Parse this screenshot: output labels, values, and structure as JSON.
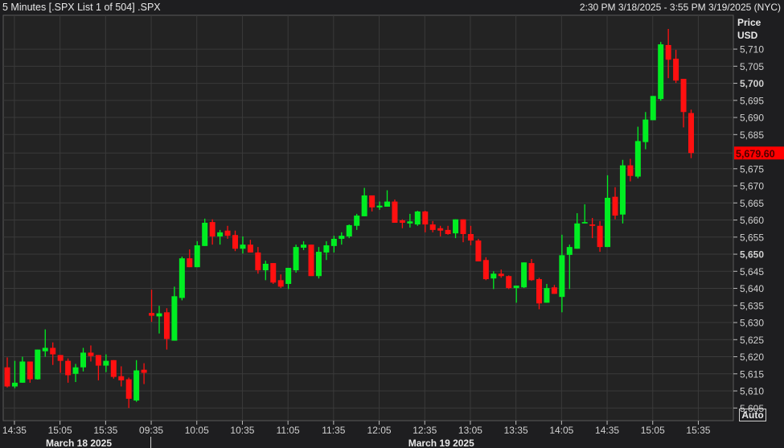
{
  "header": {
    "title": "5 Minutes [.SPX List 1 of 504] .SPX",
    "range": "2:30 PM 3/18/2025 - 3:55 PM 3/19/2025 (NYC)"
  },
  "auto_button": "Auto",
  "colors": {
    "up": "#00ee22",
    "down": "#ff1010",
    "last_price_bg": "#ff0000",
    "grid": "#3a3a3a",
    "plot_bg": "#232323"
  },
  "chart_data": {
    "type": "candlestick",
    "title": "5 Minutes [.SPX List 1 of 504] .SPX",
    "ylabel": "Price",
    "yunit": "USD",
    "ylim": [
      5601.3,
      5719.9
    ],
    "yticks": [
      5710,
      5705,
      5700,
      5695,
      5690,
      5685,
      5675,
      5670,
      5665,
      5660,
      5655,
      5650,
      5645,
      5640,
      5635,
      5630,
      5625,
      5620,
      5615,
      5610,
      5605
    ],
    "ytick_labels": [
      "5,710",
      "5,705",
      "5,700",
      "5,695",
      "5,690",
      "5,685",
      "5,675",
      "5,670",
      "5,665",
      "5,660",
      "5,655",
      "5,650",
      "5,645",
      "5,640",
      "5,635",
      "5,630",
      "5,625",
      "5,620",
      "5,615",
      "5,610",
      "5,605"
    ],
    "ytick_bold": [
      "5,700",
      "5,650"
    ],
    "last_price": 5679.6,
    "last_price_label": "5,679.60",
    "grid": true,
    "xtick_labels": [
      {
        "label": "14:35",
        "index": 1
      },
      {
        "label": "15:05",
        "index": 7
      },
      {
        "label": "15:35",
        "index": 13
      },
      {
        "label": "09:35",
        "index": 19
      },
      {
        "label": "10:05",
        "index": 25
      },
      {
        "label": "10:35",
        "index": 31
      },
      {
        "label": "11:05",
        "index": 37
      },
      {
        "label": "11:35",
        "index": 43
      },
      {
        "label": "12:05",
        "index": 49
      },
      {
        "label": "12:35",
        "index": 55
      },
      {
        "label": "13:05",
        "index": 61
      },
      {
        "label": "13:35",
        "index": 67
      },
      {
        "label": "14:05",
        "index": 73
      },
      {
        "label": "14:35",
        "index": 79
      },
      {
        "label": "15:05",
        "index": 85
      },
      {
        "label": "15:35",
        "index": 91
      }
    ],
    "date_labels": [
      {
        "label": "March 18 2025",
        "from": 0,
        "to": 18
      },
      {
        "label": "March 19 2025",
        "from": 19,
        "to": 91
      }
    ],
    "columns": [
      "time",
      "open",
      "high",
      "low",
      "close"
    ],
    "candles": [
      [
        "3/18 14:30",
        5616.9,
        5619.8,
        5611.0,
        5611.3
      ],
      [
        "3/18 14:35",
        5611.3,
        5618.8,
        5610.8,
        5612.4
      ],
      [
        "3/18 14:40",
        5612.4,
        5620.0,
        5612.4,
        5618.6
      ],
      [
        "3/18 14:45",
        5618.6,
        5618.6,
        5612.4,
        5613.4
      ],
      [
        "3/18 14:50",
        5613.4,
        5622.1,
        5613.3,
        5622.1
      ],
      [
        "3/18 14:55",
        5621.6,
        5628.0,
        5620.0,
        5622.6
      ],
      [
        "3/18 15:00",
        5622.6,
        5624.2,
        5617.6,
        5620.7
      ],
      [
        "3/18 15:05",
        5620.5,
        5620.5,
        5615.3,
        5618.8
      ],
      [
        "3/18 15:10",
        5618.8,
        5619.5,
        5612.4,
        5614.6
      ],
      [
        "3/18 15:15",
        5615.0,
        5617.9,
        5612.6,
        5616.9
      ],
      [
        "3/18 15:20",
        5616.9,
        5622.6,
        5615.7,
        5621.2
      ],
      [
        "3/18 15:25",
        5621.2,
        5623.3,
        5618.6,
        5620.2
      ],
      [
        "3/18 15:30",
        5620.5,
        5620.5,
        5613.1,
        5617.4
      ],
      [
        "3/18 15:35",
        5617.4,
        5620.7,
        5615.5,
        5618.8
      ],
      [
        "3/18 15:40",
        5619.0,
        5619.0,
        5613.6,
        5614.1
      ],
      [
        "3/18 15:45",
        5614.3,
        5617.2,
        5611.3,
        5613.1
      ],
      [
        "3/18 15:50",
        5613.4,
        5613.9,
        5605.0,
        5607.7
      ],
      [
        "3/18 15:55",
        5607.2,
        5619.0,
        5606.8,
        5616.0
      ],
      [
        "3/18 16:00",
        5616.2,
        5618.1,
        5612.0,
        5615.3
      ],
      [
        "3/19 09:35",
        5632.8,
        5639.6,
        5630.2,
        5632.0
      ],
      [
        "3/19 09:40",
        5631.8,
        5634.9,
        5626.8,
        5632.7
      ],
      [
        "3/19 09:45",
        5633.0,
        5634.2,
        5622.1,
        5625.2
      ],
      [
        "3/19 09:50",
        5624.7,
        5640.5,
        5624.7,
        5637.7
      ],
      [
        "3/19 09:55",
        5637.2,
        5649.3,
        5636.5,
        5648.8
      ],
      [
        "3/19 10:00",
        5648.8,
        5651.4,
        5646.2,
        5646.2
      ],
      [
        "3/19 10:05",
        5646.2,
        5653.8,
        5646.2,
        5652.6
      ],
      [
        "3/19 10:10",
        5652.4,
        5660.4,
        5652.4,
        5659.2
      ],
      [
        "3/19 10:15",
        5659.4,
        5660.2,
        5652.8,
        5655.2
      ],
      [
        "3/19 10:20",
        5655.2,
        5657.1,
        5652.8,
        5656.4
      ],
      [
        "3/19 10:25",
        5656.9,
        5658.3,
        5654.5,
        5655.4
      ],
      [
        "3/19 10:30",
        5655.6,
        5656.9,
        5650.9,
        5651.6
      ],
      [
        "3/19 10:35",
        5651.6,
        5655.2,
        5650.2,
        5652.8
      ],
      [
        "3/19 10:40",
        5652.8,
        5654.2,
        5650.5,
        5650.5
      ],
      [
        "3/19 10:45",
        5650.5,
        5652.1,
        5644.3,
        5645.3
      ],
      [
        "3/19 10:50",
        5645.3,
        5648.1,
        5642.4,
        5647.2
      ],
      [
        "3/19 10:55",
        5647.4,
        5647.4,
        5641.3,
        5641.7
      ],
      [
        "3/19 11:00",
        5642.4,
        5644.1,
        5640.1,
        5640.5
      ],
      [
        "3/19 11:05",
        5641.3,
        5646.0,
        5639.8,
        5646.0
      ],
      [
        "3/19 11:10",
        5645.3,
        5652.8,
        5644.6,
        5652.1
      ],
      [
        "3/19 11:15",
        5651.9,
        5653.8,
        5651.2,
        5652.8
      ],
      [
        "3/19 11:20",
        5652.8,
        5652.8,
        5643.6,
        5643.6
      ],
      [
        "3/19 11:25",
        5643.6,
        5652.1,
        5642.9,
        5650.7
      ],
      [
        "3/19 11:30",
        5650.5,
        5653.8,
        5648.3,
        5652.6
      ],
      [
        "3/19 11:35",
        5652.4,
        5655.4,
        5650.5,
        5654.5
      ],
      [
        "3/19 11:40",
        5654.5,
        5656.4,
        5652.8,
        5655.4
      ],
      [
        "3/19 11:45",
        5655.2,
        5658.7,
        5654.7,
        5658.5
      ],
      [
        "3/19 11:50",
        5658.3,
        5661.8,
        5657.1,
        5661.3
      ],
      [
        "3/19 11:55",
        5661.1,
        5669.4,
        5661.1,
        5667.2
      ],
      [
        "3/19 12:00",
        5667.2,
        5667.2,
        5662.5,
        5663.7
      ],
      [
        "3/19 12:05",
        5663.7,
        5665.4,
        5663.0,
        5664.2
      ],
      [
        "3/19 12:10",
        5663.9,
        5668.7,
        5663.9,
        5665.4
      ],
      [
        "3/19 12:15",
        5665.4,
        5666.0,
        5659.2,
        5659.2
      ],
      [
        "3/19 12:20",
        5659.9,
        5660.2,
        5657.6,
        5659.2
      ],
      [
        "3/19 12:25",
        5659.0,
        5661.8,
        5657.8,
        5659.6
      ],
      [
        "3/19 12:30",
        5658.7,
        5662.7,
        5658.3,
        5662.5
      ],
      [
        "3/19 12:35",
        5662.5,
        5662.7,
        5656.4,
        5658.7
      ],
      [
        "3/19 12:40",
        5658.7,
        5659.7,
        5656.4,
        5657.1
      ],
      [
        "3/19 12:45",
        5657.6,
        5658.3,
        5655.2,
        5656.9
      ],
      [
        "3/19 12:50",
        5657.1,
        5658.3,
        5655.7,
        5655.9
      ],
      [
        "3/19 12:55",
        5656.1,
        5660.2,
        5654.7,
        5660.2
      ],
      [
        "3/19 13:00",
        5660.2,
        5660.2,
        5653.5,
        5655.9
      ],
      [
        "3/19 13:05",
        5655.9,
        5658.3,
        5652.6,
        5654.0
      ],
      [
        "3/19 13:10",
        5654.0,
        5654.5,
        5647.9,
        5647.9
      ],
      [
        "3/19 13:15",
        5648.3,
        5649.1,
        5642.4,
        5642.7
      ],
      [
        "3/19 13:20",
        5642.9,
        5645.0,
        5639.8,
        5644.3
      ],
      [
        "3/19 13:25",
        5644.3,
        5645.5,
        5643.1,
        5643.6
      ],
      [
        "3/19 13:30",
        5643.6,
        5643.8,
        5639.8,
        5640.1
      ],
      [
        "3/19 13:35",
        5640.1,
        5640.8,
        5635.8,
        5640.8
      ],
      [
        "3/19 13:40",
        5640.3,
        5647.6,
        5640.1,
        5647.6
      ],
      [
        "3/19 13:45",
        5647.4,
        5648.6,
        5642.2,
        5642.4
      ],
      [
        "3/19 13:50",
        5642.7,
        5643.1,
        5633.9,
        5635.6
      ],
      [
        "3/19 13:55",
        5635.8,
        5641.3,
        5635.8,
        5640.1
      ],
      [
        "3/19 14:00",
        5640.3,
        5641.0,
        5638.4,
        5638.4
      ],
      [
        "3/19 14:05",
        5637.5,
        5655.7,
        5633.0,
        5649.7
      ],
      [
        "3/19 14:10",
        5649.8,
        5652.8,
        5639.8,
        5652.1
      ],
      [
        "3/19 14:15",
        5651.6,
        5662.0,
        5651.6,
        5659.0
      ],
      [
        "3/19 14:20",
        5659.0,
        5664.6,
        5659.0,
        5659.4
      ],
      [
        "3/19 14:25",
        5658.7,
        5660.6,
        5654.7,
        5658.3
      ],
      [
        "3/19 14:30",
        5658.3,
        5659.7,
        5650.7,
        5652.1
      ],
      [
        "3/19 14:35",
        5652.1,
        5673.1,
        5652.1,
        5666.5
      ],
      [
        "3/19 14:40",
        5666.8,
        5669.6,
        5660.2,
        5661.3
      ],
      [
        "3/19 14:45",
        5661.6,
        5677.6,
        5659.0,
        5676.0
      ],
      [
        "3/19 14:50",
        5676.0,
        5677.9,
        5671.3,
        5672.9
      ],
      [
        "3/19 14:55",
        5672.7,
        5687.3,
        5672.2,
        5683.1
      ],
      [
        "3/19 15:00",
        5682.8,
        5691.6,
        5680.7,
        5689.4
      ],
      [
        "3/19 15:05",
        5689.2,
        5696.3,
        5689.2,
        5696.3
      ],
      [
        "3/19 15:10",
        5695.4,
        5712.1,
        5694.9,
        5711.4
      ],
      [
        "3/19 15:15",
        5711.2,
        5715.9,
        5701.5,
        5706.9
      ],
      [
        "3/19 15:20",
        5707.2,
        5709.8,
        5700.1,
        5700.8
      ],
      [
        "3/19 15:25",
        5701.3,
        5701.3,
        5687.1,
        5691.6
      ],
      [
        "3/19 15:30",
        5691.3,
        5692.3,
        5678.1,
        5679.6
      ]
    ]
  }
}
